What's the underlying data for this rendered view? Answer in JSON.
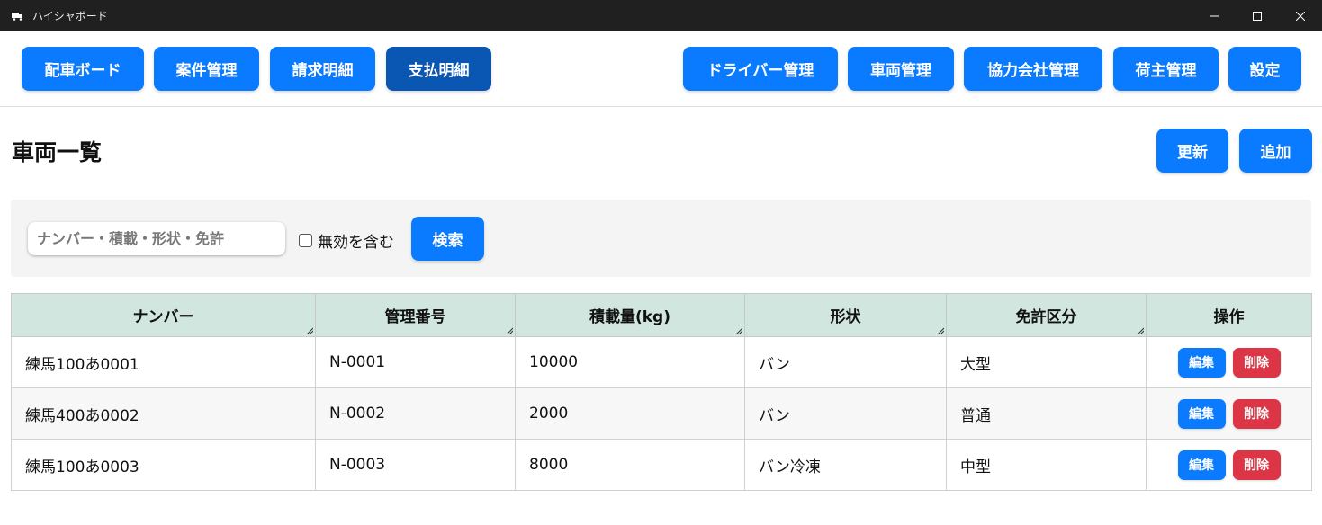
{
  "window": {
    "title": "ハイシャボード"
  },
  "nav": {
    "left": [
      {
        "id": "dispatch",
        "label": "配車ボード"
      },
      {
        "id": "cases",
        "label": "案件管理"
      },
      {
        "id": "billing",
        "label": "請求明細"
      },
      {
        "id": "payment",
        "label": "支払明細"
      }
    ],
    "right": [
      {
        "id": "drivers",
        "label": "ドライバー管理"
      },
      {
        "id": "vehicles",
        "label": "車両管理"
      },
      {
        "id": "partners",
        "label": "協力会社管理"
      },
      {
        "id": "shippers",
        "label": "荷主管理"
      },
      {
        "id": "settings",
        "label": "設定"
      }
    ],
    "active": "payment"
  },
  "page": {
    "title": "車両一覧",
    "refresh_label": "更新",
    "add_label": "追加"
  },
  "search": {
    "placeholder": "ナンバー・積載・形状・免許",
    "value": "",
    "include_inactive_label": "無効を含む",
    "include_inactive_checked": false,
    "button_label": "検索"
  },
  "table": {
    "columns": [
      "ナンバー",
      "管理番号",
      "積載量(kg)",
      "形状",
      "免許区分",
      "操作"
    ],
    "rows": [
      {
        "number": "練馬100あ0001",
        "mgmt": "N-0001",
        "load": "10000",
        "shape": "バン",
        "license": "大型"
      },
      {
        "number": "練馬400あ0002",
        "mgmt": "N-0002",
        "load": "2000",
        "shape": "バン",
        "license": "普通"
      },
      {
        "number": "練馬100あ0003",
        "mgmt": "N-0003",
        "load": "8000",
        "shape": "バン冷凍",
        "license": "中型"
      }
    ],
    "edit_label": "編集",
    "delete_label": "削除"
  },
  "colors": {
    "primary": "#0a7bff",
    "active": "#0a56b3",
    "danger": "#dc3545",
    "header_bg": "#d1e6de"
  }
}
